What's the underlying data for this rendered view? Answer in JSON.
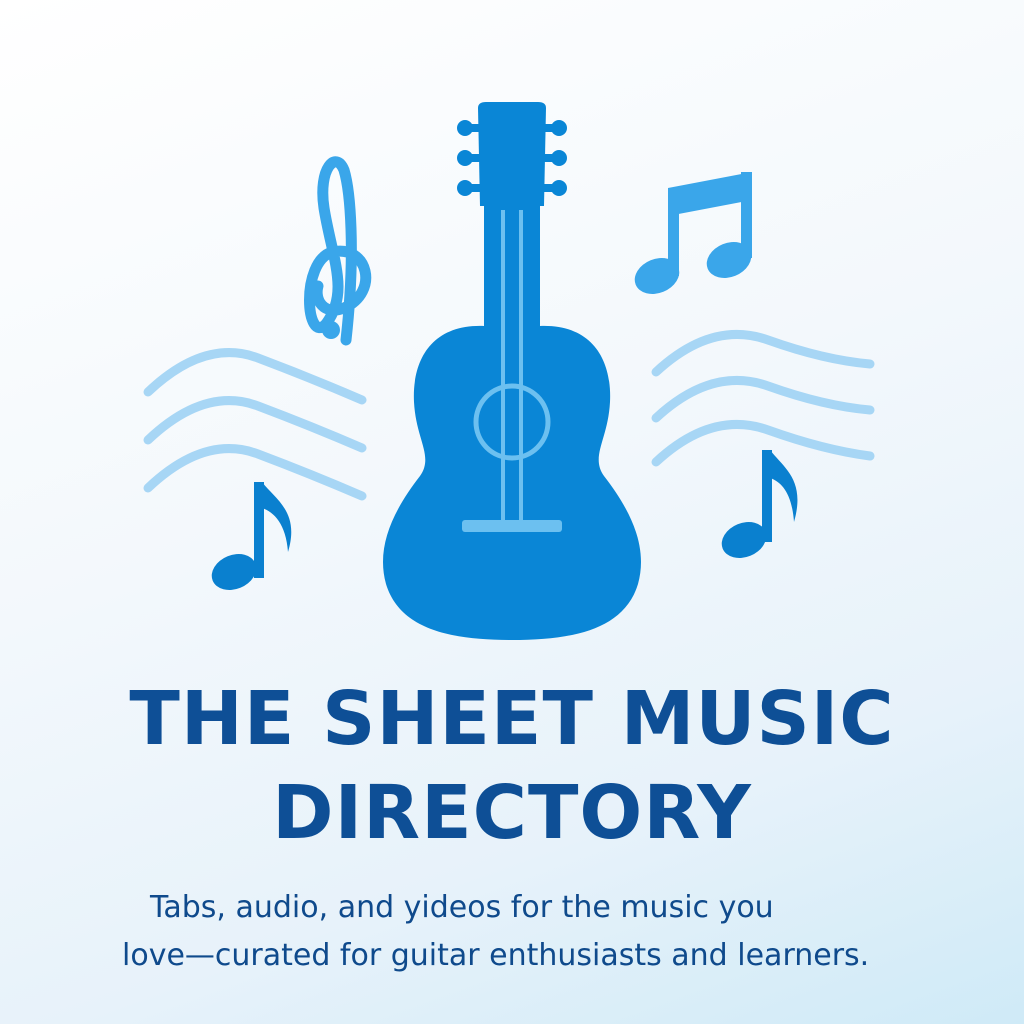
{
  "colors": {
    "guitar": "#0a86d6",
    "note_light": "#3aa6ea",
    "wave": "#a7d6f5",
    "title": "#0e4f96",
    "tagline": "#0f4a8c"
  },
  "icons": [
    "treble-clef-icon",
    "guitar-icon",
    "beamed-notes-icon",
    "eighth-note-icon",
    "sound-wave-icon"
  ],
  "title": {
    "line1": "THE SHEET MUSIC",
    "line2": "DIRECTORY"
  },
  "tagline": {
    "line1": "Tabs, audio, and yideos for the music you",
    "line2": "love—curated for guitar enthusiasts and learners."
  }
}
